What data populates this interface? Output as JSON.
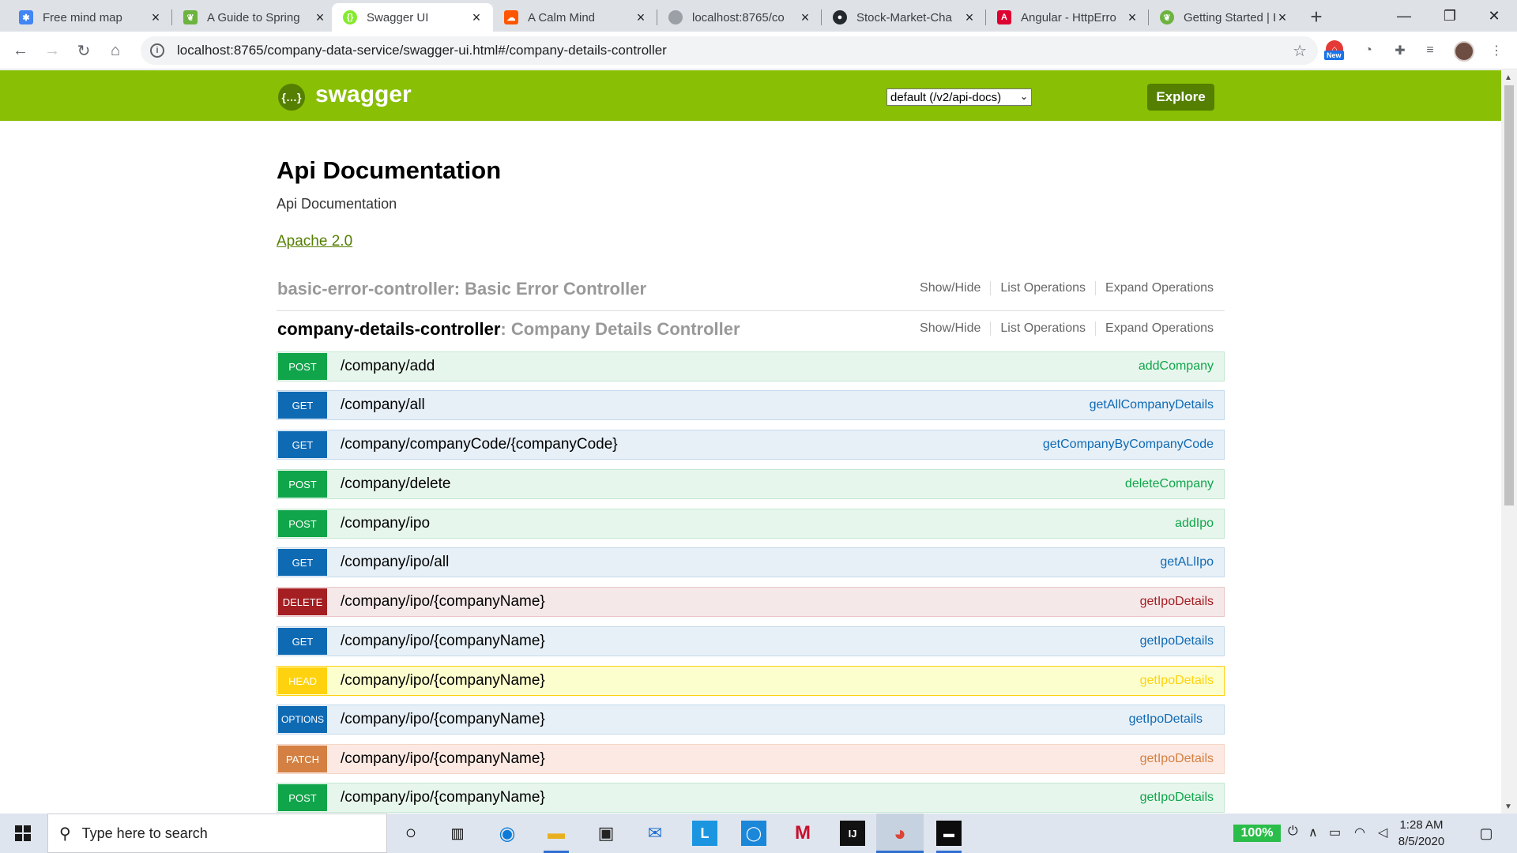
{
  "browser": {
    "tabs": [
      {
        "title": "Free mind map",
        "favicon": "mindmap-icon",
        "color": "#4285f4"
      },
      {
        "title": "A Guide to Spring",
        "favicon": "leaf-icon",
        "color": "#6db33f"
      },
      {
        "title": "Swagger UI",
        "favicon": "swagger-icon",
        "color": "#85ea2d",
        "active": true
      },
      {
        "title": "A Calm Mind",
        "favicon": "soundcloud-icon",
        "color": "#ff5500"
      },
      {
        "title": "localhost:8765/co",
        "favicon": "globe-icon",
        "color": "#5f6368"
      },
      {
        "title": "Stock-Market-Cha",
        "favicon": "github-icon",
        "color": "#24292e"
      },
      {
        "title": "Angular - HttpErro",
        "favicon": "angular-icon",
        "color": "#dd0031"
      },
      {
        "title": "Getting Started | E",
        "favicon": "spring-icon",
        "color": "#6db33f"
      }
    ],
    "url": "localhost:8765/company-data-service/swagger-ui.html#/company-details-controller",
    "extension_badge": "New"
  },
  "swagger": {
    "logo_text": "swagger",
    "spec_selector": "default (/v2/api-docs)",
    "explore_label": "Explore",
    "brand_color": "#89bf04"
  },
  "api": {
    "title": "Api Documentation",
    "description": "Api Documentation",
    "license": "Apache 2.0"
  },
  "controllers": [
    {
      "name": "basic-error-controller",
      "description": ": Basic Error Controller",
      "show_hide": "Show/Hide",
      "list_ops": "List Operations",
      "expand_ops": "Expand Operations"
    },
    {
      "name": "company-details-controller",
      "description": ": Company Details Controller",
      "show_hide": "Show/Hide",
      "list_ops": "List Operations",
      "expand_ops": "Expand Operations"
    }
  ],
  "operations": [
    {
      "method": "POST",
      "path": "/company/add",
      "op_id": "addCompany"
    },
    {
      "method": "GET",
      "path": "/company/all",
      "op_id": "getAllCompanyDetails"
    },
    {
      "method": "GET",
      "path": "/company/companyCode/{companyCode}",
      "op_id": "getCompanyByCompanyCode"
    },
    {
      "method": "POST",
      "path": "/company/delete",
      "op_id": "deleteCompany"
    },
    {
      "method": "POST",
      "path": "/company/ipo",
      "op_id": "addIpo"
    },
    {
      "method": "GET",
      "path": "/company/ipo/all",
      "op_id": "getALlIpo"
    },
    {
      "method": "DELETE",
      "path": "/company/ipo/{companyName}",
      "op_id": "getIpoDetails"
    },
    {
      "method": "GET",
      "path": "/company/ipo/{companyName}",
      "op_id": "getIpoDetails"
    },
    {
      "method": "HEAD",
      "path": "/company/ipo/{companyName}",
      "op_id": "getIpoDetails"
    },
    {
      "method": "OPTIONS",
      "path": "/company/ipo/{companyName}",
      "op_id": "getIpoDetails"
    },
    {
      "method": "PATCH",
      "path": "/company/ipo/{companyName}",
      "op_id": "getIpoDetails"
    },
    {
      "method": "POST",
      "path": "/company/ipo/{companyName}",
      "op_id": "getIpoDetails"
    }
  ],
  "taskbar": {
    "search_placeholder": "Type here to search",
    "pinned": [
      "cortana-icon",
      "task-view-icon",
      "edge-icon",
      "file-explorer-icon",
      "store-icon",
      "mail-icon",
      "l-app-icon",
      "photo-app-icon",
      "mcafee-icon",
      "intellij-icon",
      "chrome-icon",
      "terminal-icon"
    ],
    "battery": "100%",
    "time": "1:28 AM",
    "date": "8/5/2020"
  }
}
